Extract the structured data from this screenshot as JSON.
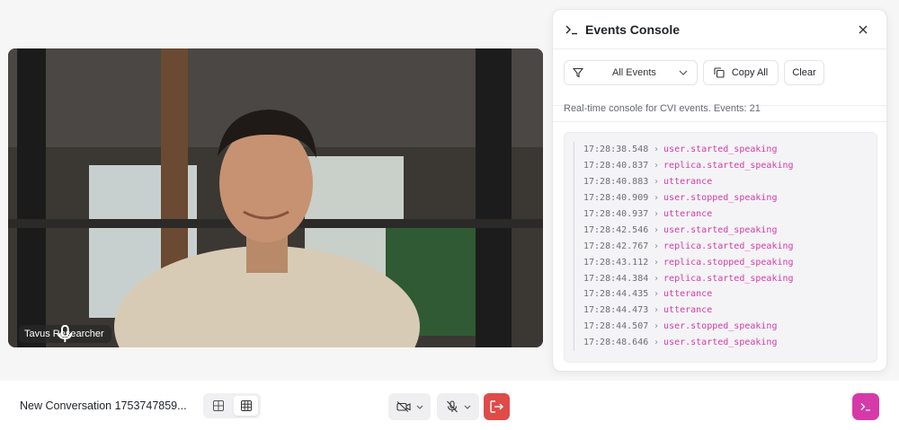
{
  "video": {
    "participant_label": "Tavus Researcher"
  },
  "console": {
    "title": "Events Console",
    "filter_value": "All Events",
    "copy_label": "Copy All",
    "clear_label": "Clear",
    "subtitle": "Real-time console for CVI events. Events: 21",
    "events": [
      {
        "time": "17:28:38.548",
        "name": "user.started_speaking"
      },
      {
        "time": "17:28:40.837",
        "name": "replica.started_speaking"
      },
      {
        "time": "17:28:40.883",
        "name": "utterance"
      },
      {
        "time": "17:28:40.909",
        "name": "user.stopped_speaking"
      },
      {
        "time": "17:28:40.937",
        "name": "utterance"
      },
      {
        "time": "17:28:42.546",
        "name": "user.started_speaking"
      },
      {
        "time": "17:28:42.767",
        "name": "replica.started_speaking"
      },
      {
        "time": "17:28:43.112",
        "name": "replica.stopped_speaking"
      },
      {
        "time": "17:28:44.384",
        "name": "replica.started_speaking"
      },
      {
        "time": "17:28:44.435",
        "name": "utterance"
      },
      {
        "time": "17:28:44.473",
        "name": "utterance"
      },
      {
        "time": "17:28:44.507",
        "name": "user.stopped_speaking"
      },
      {
        "time": "17:28:48.646",
        "name": "user.started_speaking"
      }
    ]
  },
  "bottom_bar": {
    "conversation_title": "New Conversation 1753747859..."
  },
  "colors": {
    "accent": "#d63aa9",
    "leave": "#e04a48"
  }
}
